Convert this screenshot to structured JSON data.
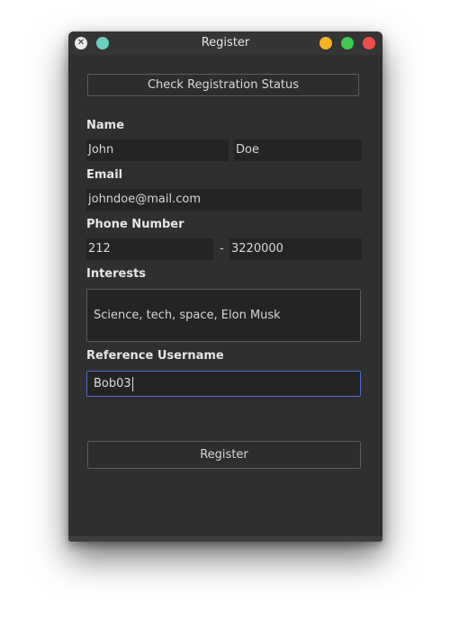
{
  "window": {
    "title": "Register",
    "colors": {
      "background": "#2f2f2f",
      "titlebar": "#353535",
      "teal_button": "#6ccfbf",
      "minimize": "#f5b223",
      "maximize": "#3fc951",
      "close": "#f04a4a",
      "focus_border": "#4a6fd6"
    },
    "left_icon": "x-close-icon"
  },
  "status_button": {
    "label": "Check Registration Status"
  },
  "name": {
    "label": "Name",
    "first": "John",
    "last": "Doe"
  },
  "email": {
    "label": "Email",
    "value": "johndoe@mail.com"
  },
  "phone": {
    "label": "Phone Number",
    "area": "212",
    "separator": "-",
    "number": "3220000"
  },
  "interests": {
    "label": "Interests",
    "value": "Science, tech, space, Elon Musk"
  },
  "reference": {
    "label": "Reference Username",
    "value": "Bob03"
  },
  "register_button": {
    "label": "Register"
  }
}
